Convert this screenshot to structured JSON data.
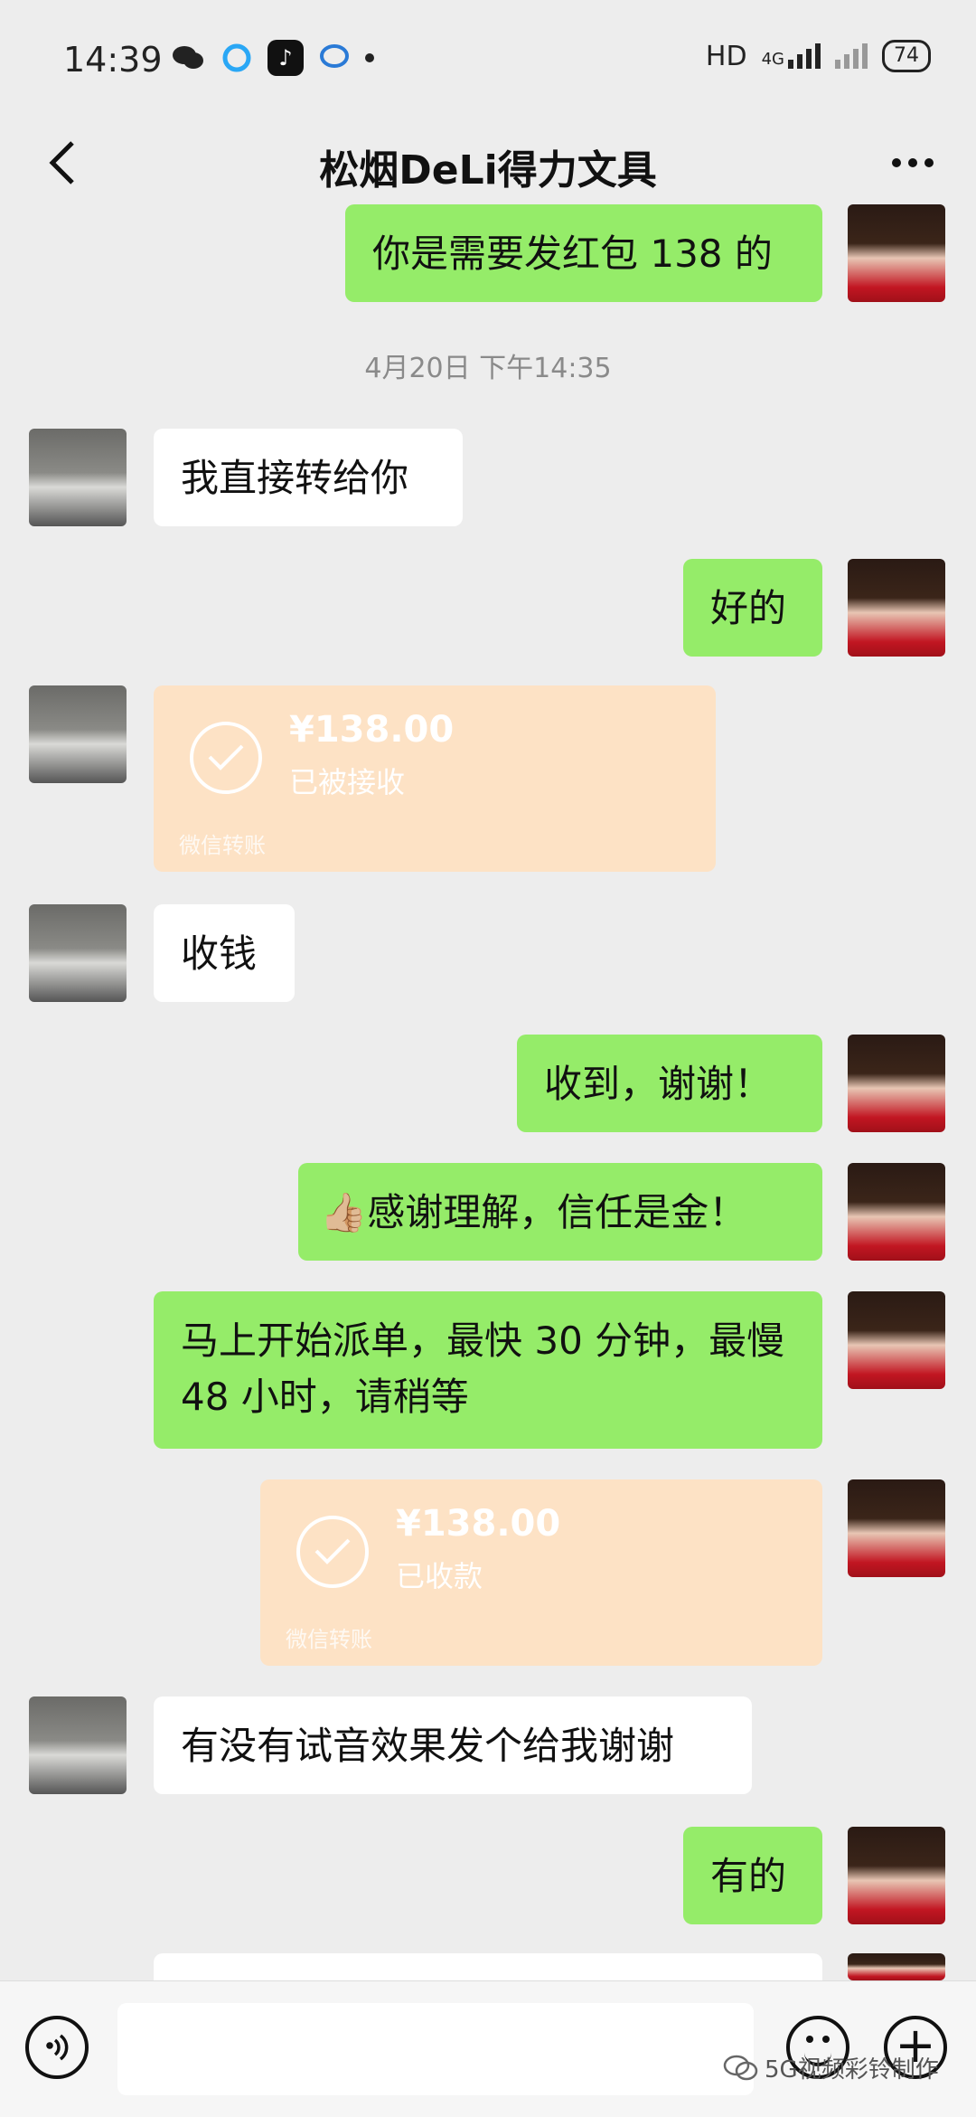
{
  "status_bar": {
    "time": "14:39",
    "network": "HD",
    "signal": "4G",
    "battery": "74"
  },
  "header": {
    "title": "松烟DeLi得力文具",
    "back_icon": "chevron-left-icon",
    "more_icon": "more-dots-icon"
  },
  "messages": [
    {
      "side": "me",
      "text": "你是需要发红包 138 的"
    },
    {
      "timestamp": "4月20日 下午14:35"
    },
    {
      "side": "them",
      "text": "我直接转给你"
    },
    {
      "side": "me",
      "text": "好的"
    },
    {
      "side": "them",
      "type": "transfer",
      "amount": "¥138.00",
      "status": "已被接收",
      "footer": "微信转账"
    },
    {
      "side": "them",
      "text": "收钱"
    },
    {
      "side": "me",
      "text": "收到，谢谢！"
    },
    {
      "side": "me",
      "text": "感谢理解，信任是金！",
      "emoji": "👍🏼"
    },
    {
      "side": "me",
      "text": "马上开始派单，最快 30 分钟，最慢 48 小时，请稍等"
    },
    {
      "side": "me",
      "type": "transfer",
      "amount": "¥138.00",
      "status": "已收款",
      "footer": "微信转账"
    },
    {
      "side": "them",
      "text": "有没有试音效果发个给我谢谢"
    },
    {
      "side": "me",
      "text": "有的"
    }
  ],
  "input_bar": {
    "placeholder": "",
    "voice_icon": "voice-icon",
    "emoji_icon": "emoji-icon",
    "plus_icon": "plus-icon"
  },
  "watermark": "5G视频彩铃制作",
  "colors": {
    "me_bubble": "#95ec69",
    "them_bubble": "#ffffff",
    "transfer": "#fde2c5",
    "background": "#ededed"
  }
}
